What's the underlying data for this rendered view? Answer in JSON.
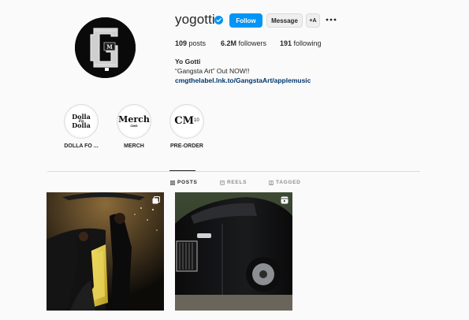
{
  "profile": {
    "username": "yogotti",
    "verified": true,
    "buttons": {
      "follow": "Follow",
      "message": "Message",
      "suggest": "+A",
      "more": "more-options-icon"
    },
    "stats": {
      "posts_count": "109",
      "posts_label": "posts",
      "followers_count": "6.2M",
      "followers_label": "followers",
      "following_count": "191",
      "following_label": "following"
    },
    "bio": {
      "name": "Yo Gotti",
      "text": "“Gangsta Art” Out NOW!!",
      "link": "cmgthelabel.lnk.to/GangstaArt/applemusic"
    },
    "avatar_icon": "cmg-logo-avatar"
  },
  "highlights": [
    {
      "label": "DOLLA FO ...",
      "cover_top": "Dolla",
      "cover_mid": "Fo",
      "cover_bottom": "Dolla"
    },
    {
      "label": "MERCH",
      "cover_top": "Merch",
      "cover_bottom": "CMG"
    },
    {
      "label": "PRE-ORDER",
      "cover_top": "CM",
      "cover_sup": "10"
    }
  ],
  "tabs": [
    {
      "label": "POSTS",
      "icon": "grid-icon",
      "active": true
    },
    {
      "label": "REELS",
      "icon": "reels-icon",
      "active": false
    },
    {
      "label": "TAGGED",
      "icon": "tagged-icon",
      "active": false
    }
  ],
  "posts": [
    {
      "description_icon": "multi-photo-icon"
    },
    {
      "description_icon": "reel-icon"
    }
  ],
  "colors": {
    "accent": "#0095f6",
    "link": "#00376b",
    "background": "#fafafa",
    "divider": "#dbdbdb"
  }
}
